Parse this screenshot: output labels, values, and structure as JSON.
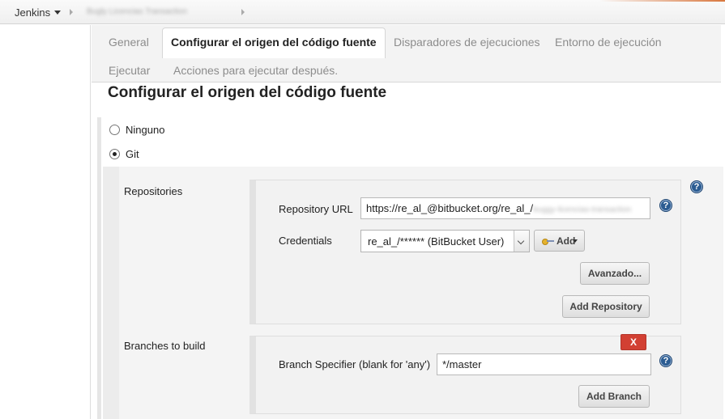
{
  "breadcrumb": {
    "root": "Jenkins",
    "project": "Bugly Licencias Transaction"
  },
  "tabs": [
    {
      "label": "General"
    },
    {
      "label": "Configurar el origen del código fuente"
    },
    {
      "label": "Disparadores de ejecuciones"
    },
    {
      "label": "Entorno de ejecución"
    },
    {
      "label": "Ejecutar"
    },
    {
      "label": "Acciones para ejecutar después."
    }
  ],
  "section": {
    "title": "Configurar el origen del código fuente",
    "options": [
      {
        "label": "Ninguno",
        "selected": false
      },
      {
        "label": "Git",
        "selected": true
      }
    ]
  },
  "repositories": {
    "label": "Repositories",
    "url_label": "Repository URL",
    "url_value": "https://re_al_@bitbucket.org/re_al_/",
    "url_value_hidden": "buggy-licencias-transaction",
    "credentials_label": "Credentials",
    "credentials_value": "re_al_/****** (BitBucket User)",
    "add_label": "Add",
    "advanced_label": "Avanzado...",
    "add_repository_label": "Add Repository"
  },
  "branches": {
    "label": "Branches to build",
    "delete_label": "X",
    "specifier_label": "Branch Specifier (blank for 'any')",
    "specifier_value": "*/master",
    "add_branch_label": "Add Branch"
  },
  "help": {
    "glyph": "?"
  },
  "colors": {
    "delete_button": "#d24033",
    "help_icon": "#2b5c92",
    "active_tab_text": "#222222",
    "inactive_tab_text": "#8c8c8c"
  }
}
